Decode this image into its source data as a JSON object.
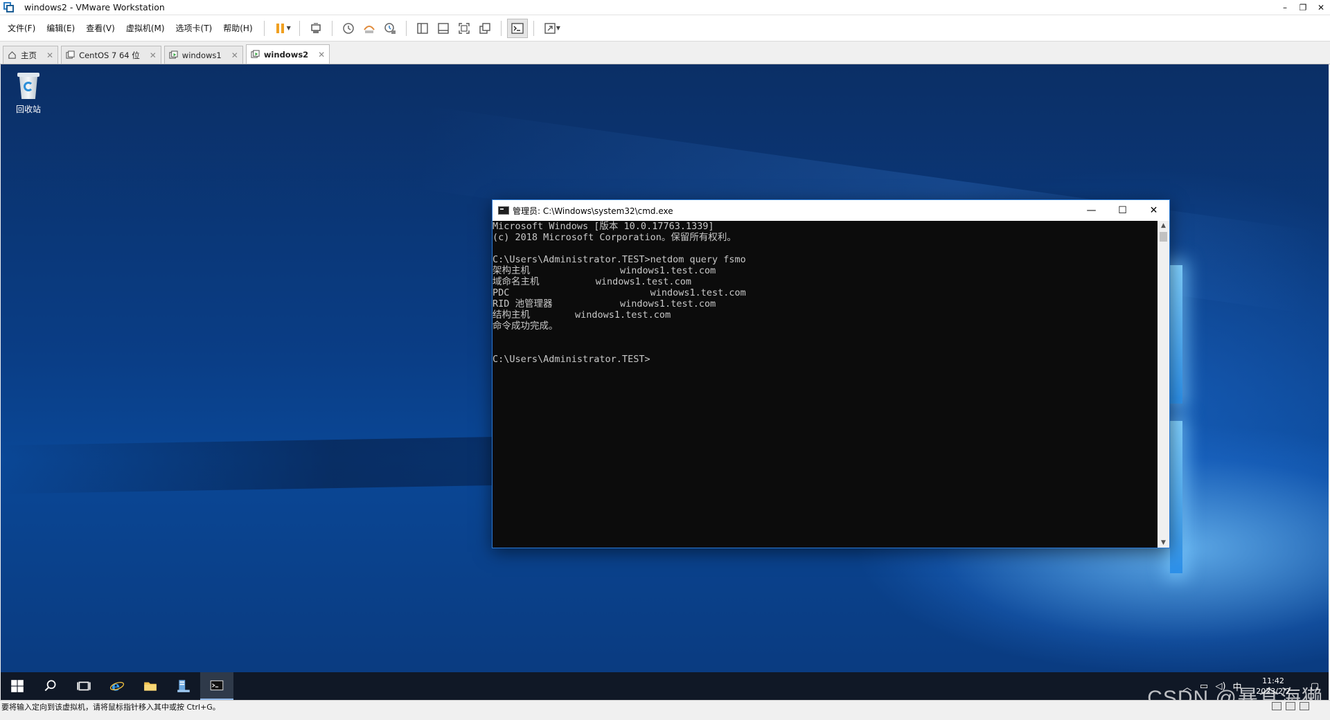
{
  "window": {
    "title": "windows2 - VMware Workstation",
    "controls": [
      "–",
      "❐",
      "✕"
    ]
  },
  "menu": [
    "文件(F)",
    "编辑(E)",
    "查看(V)",
    "虚拟机(M)",
    "选项卡(T)",
    "帮助(H)"
  ],
  "toolbar_icons": [
    "pause-icon",
    "send-ctrl-alt-del-icon",
    "snapshot-take-icon",
    "snapshot-revert-icon",
    "snapshot-manager-icon",
    "show-library-icon",
    "thumbnail-bar-icon",
    "full-screen-icon",
    "unity-icon",
    "console-view-icon",
    "stretch-guest-icon"
  ],
  "tabs": [
    {
      "label": "主页",
      "icon": "home-icon",
      "active": false
    },
    {
      "label": "CentOS 7 64 位",
      "icon": "vm-icon",
      "active": false
    },
    {
      "label": "windows1",
      "icon": "vm-running-icon",
      "active": false
    },
    {
      "label": "windows2",
      "icon": "vm-running-icon",
      "active": true
    }
  ],
  "desktop": {
    "recycle_bin_label": "回收站"
  },
  "cmd": {
    "title": "管理员: C:\\Windows\\system32\\cmd.exe",
    "lines": [
      "Microsoft Windows [版本 10.0.17763.1339]",
      "(c) 2018 Microsoft Corporation。保留所有权利。",
      "",
      "C:\\Users\\Administrator.TEST>netdom query fsmo",
      "架构主机                windows1.test.com",
      "域命名主机          windows1.test.com",
      "PDC                         windows1.test.com",
      "RID 池管理器            windows1.test.com",
      "结构主机        windows1.test.com",
      "命令成功完成。",
      "",
      "",
      "C:\\Users\\Administrator.TEST>"
    ]
  },
  "taskbar": {
    "items": [
      "start-icon",
      "search-icon",
      "task-view-icon",
      "internet-explorer-icon",
      "file-explorer-icon",
      "server-manager-icon",
      "cmd-icon"
    ],
    "clock_time": "11:42",
    "clock_date": "2023/2/2"
  },
  "statusbar": {
    "text": "要将输入定向到该虚拟机，请将鼠标指针移入其中或按 Ctrl+G。"
  },
  "watermark": "CSDN @暴食海獭",
  "colors": {
    "accent": "#2e7ec4",
    "cmd_bg": "#0c0c0c",
    "cmd_fg": "#c8c8c8",
    "taskbar_bg": "#101826"
  }
}
